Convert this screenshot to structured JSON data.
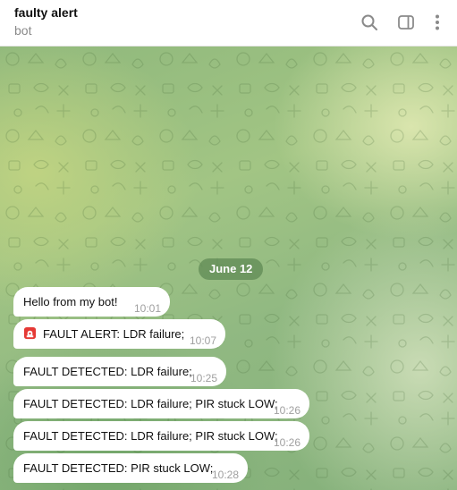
{
  "header": {
    "chat_name": "faulty alert",
    "chat_status": "bot",
    "icons": {
      "search": "search-icon",
      "sidebar": "sidebar-toggle-icon",
      "menu": "more-vertical-icon"
    }
  },
  "chat": {
    "date_label": "June 12",
    "messages": [
      {
        "text": "Hello from my bot!",
        "time": "10:01"
      },
      {
        "icon": "police-siren-icon",
        "text": "FAULT ALERT: LDR failure;",
        "time": "10:07"
      },
      {
        "text": "FAULT DETECTED: LDR failure;",
        "time": "10:25"
      },
      {
        "text": "FAULT DETECTED: LDR failure; PIR stuck LOW;",
        "time": "10:26"
      },
      {
        "text": "FAULT DETECTED: LDR failure; PIR stuck LOW;",
        "time": "10:26"
      },
      {
        "text": "FAULT DETECTED: PIR stuck LOW;",
        "time": "10:28"
      }
    ]
  },
  "colors": {
    "bubble": "#ffffff",
    "date_pill": "#628c56",
    "time_text": "#a0a0a0",
    "icon_gray": "#8a8a8a",
    "siren_red": "#e53935"
  }
}
